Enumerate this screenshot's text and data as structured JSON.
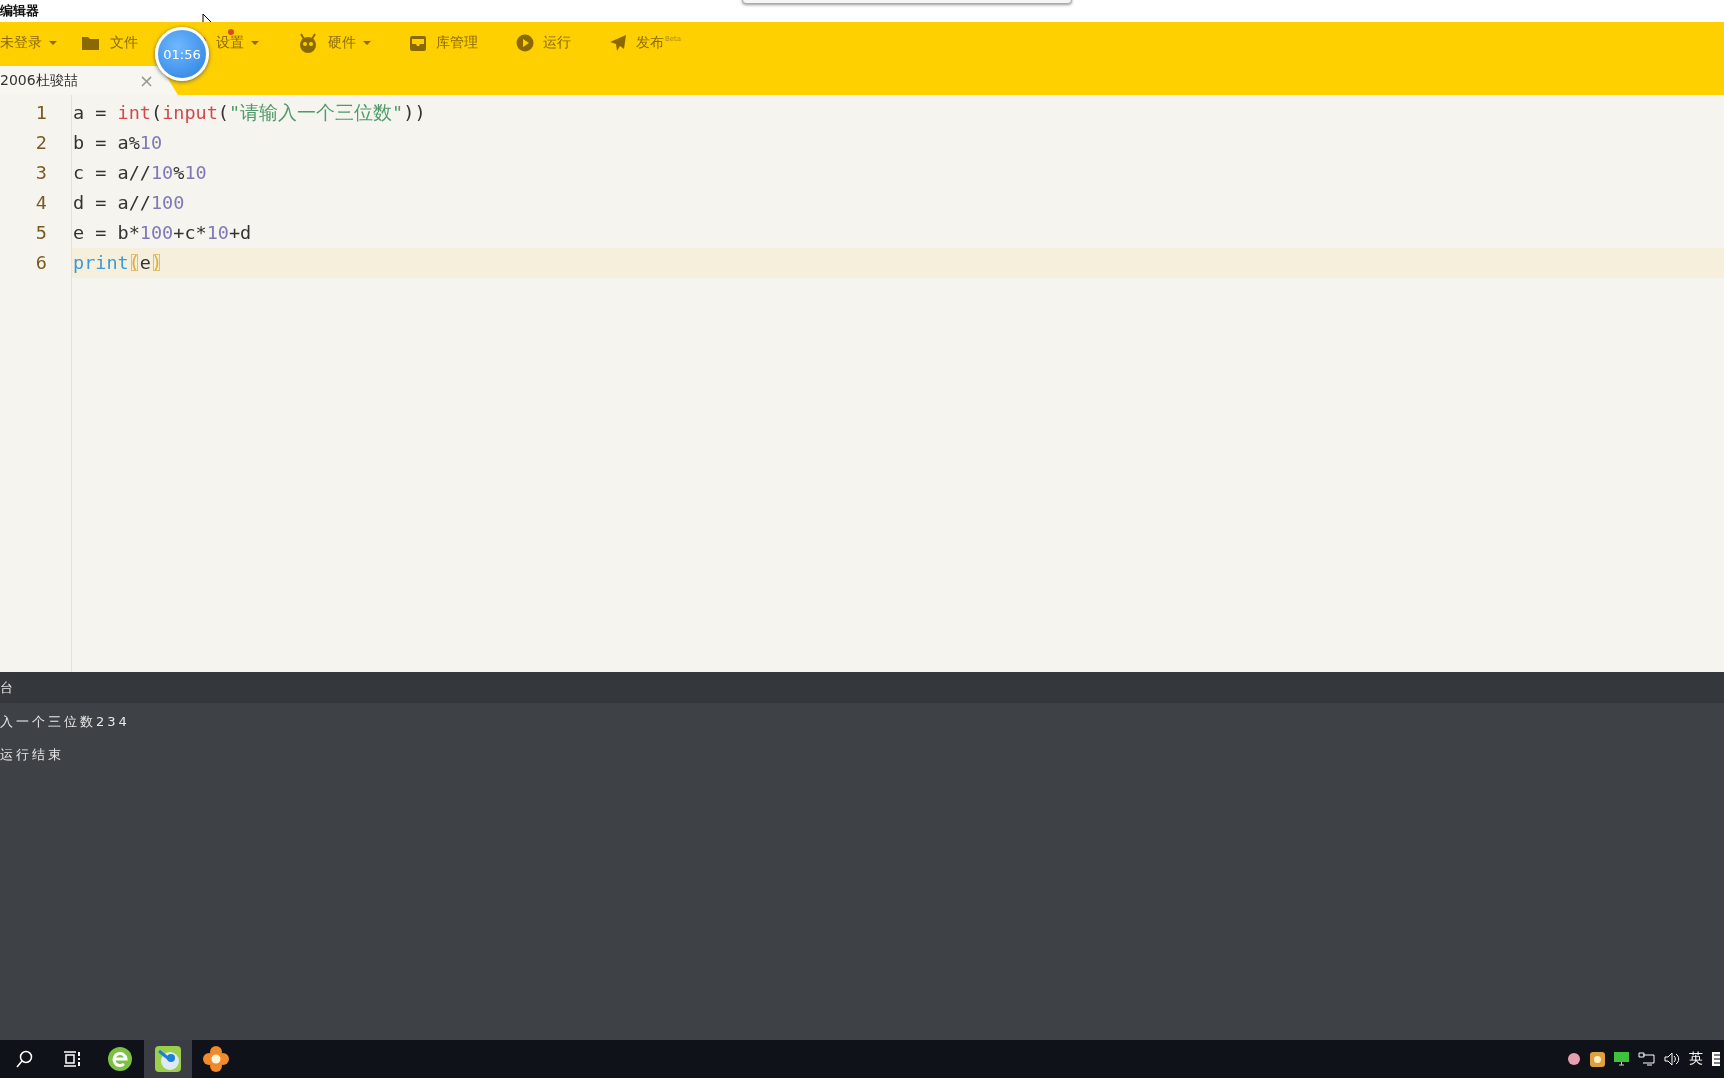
{
  "window": {
    "title": "编辑器"
  },
  "toolbar": [
    {
      "label": "未登录",
      "dropdown": true,
      "dot": false
    },
    {
      "label": "文件",
      "dropdown": false,
      "dot": false
    },
    {
      "label": "设置",
      "dropdown": true,
      "dot": true
    },
    {
      "label": "硬件",
      "dropdown": true,
      "dot": false
    },
    {
      "label": "库管理",
      "dropdown": false,
      "dot": false
    },
    {
      "label": "运行",
      "dropdown": false,
      "dot": false
    },
    {
      "label": "发布",
      "dropdown": false,
      "dot": false,
      "badge": "Beta"
    }
  ],
  "timer": "01:56",
  "tabs": [
    {
      "label": "2006杜骏喆",
      "selected": true,
      "close": "×"
    }
  ],
  "editor": {
    "lines": [
      {
        "number": "1",
        "current": false,
        "tokens": [
          {
            "kind": "plain",
            "text": "a = "
          },
          {
            "kind": "builtin",
            "text": "int"
          },
          {
            "kind": "plain",
            "text": "("
          },
          {
            "kind": "builtin",
            "text": "input"
          },
          {
            "kind": "plain",
            "text": "("
          },
          {
            "kind": "string",
            "text": "\"请输入一个三位数\""
          },
          {
            "kind": "plain",
            "text": "))"
          }
        ]
      },
      {
        "number": "2",
        "current": false,
        "tokens": [
          {
            "kind": "plain",
            "text": "b = a%"
          },
          {
            "kind": "number",
            "text": "10"
          }
        ]
      },
      {
        "number": "3",
        "current": false,
        "tokens": [
          {
            "kind": "plain",
            "text": "c = a//"
          },
          {
            "kind": "number",
            "text": "10"
          },
          {
            "kind": "plain",
            "text": "%"
          },
          {
            "kind": "number",
            "text": "10"
          }
        ]
      },
      {
        "number": "4",
        "current": false,
        "tokens": [
          {
            "kind": "plain",
            "text": "d = a//"
          },
          {
            "kind": "number",
            "text": "100"
          }
        ]
      },
      {
        "number": "5",
        "current": false,
        "tokens": [
          {
            "kind": "plain",
            "text": "e = b*"
          },
          {
            "kind": "number",
            "text": "100"
          },
          {
            "kind": "plain",
            "text": "+c*"
          },
          {
            "kind": "number",
            "text": "10"
          },
          {
            "kind": "plain",
            "text": "+d"
          }
        ]
      },
      {
        "number": "6",
        "current": true,
        "tokens": [
          {
            "kind": "keyword",
            "text": "print"
          },
          {
            "kind": "bracket",
            "text": "("
          },
          {
            "kind": "plain",
            "text": "e"
          },
          {
            "kind": "bracket",
            "text": ")"
          }
        ]
      }
    ]
  },
  "console": {
    "title": "台",
    "lines": [
      "入一个三位数234",
      "运行结束"
    ]
  },
  "taskbar": {
    "apps": [
      {
        "selected": false
      },
      {
        "selected": false
      },
      {
        "selected": false
      },
      {
        "selected": true
      },
      {
        "selected": false
      }
    ],
    "tray_language": "英"
  }
}
